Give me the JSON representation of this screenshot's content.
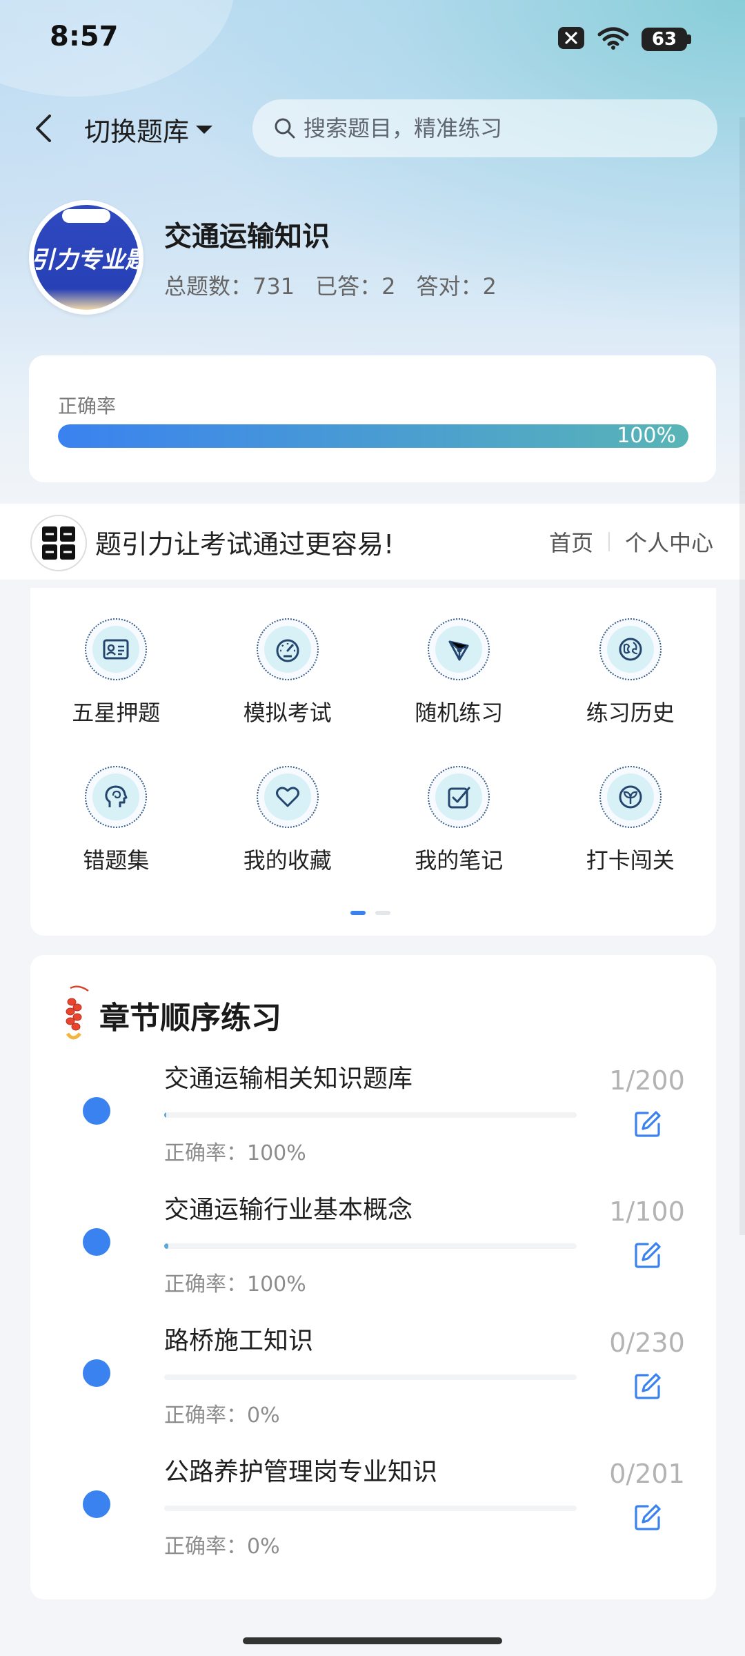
{
  "status": {
    "time": "8:57",
    "battery": "63"
  },
  "top": {
    "switch_label": "切换题库",
    "search_placeholder": "搜索题目，精准练习"
  },
  "bank": {
    "logo_text": "引力专业题",
    "title": "交通运输知识",
    "stats": {
      "total": "总题数：731",
      "answered": "已答：2",
      "correct": "答对：2"
    }
  },
  "accuracy": {
    "label": "正确率",
    "value_text": "100%",
    "value": 100
  },
  "banner": {
    "text": "题引力让考试通过更容易!",
    "links": [
      "首页",
      "个人中心"
    ]
  },
  "features": [
    {
      "label": "五星押题",
      "icon": "id-card-icon"
    },
    {
      "label": "模拟考试",
      "icon": "speedometer-icon"
    },
    {
      "label": "随机练习",
      "icon": "network-icon"
    },
    {
      "label": "练习历史",
      "icon": "globe-icon"
    },
    {
      "label": "错题集",
      "icon": "brain-head-icon"
    },
    {
      "label": "我的收藏",
      "icon": "heart-icon"
    },
    {
      "label": "我的笔记",
      "icon": "checklist-icon"
    },
    {
      "label": "打卡闯关",
      "icon": "sprout-icon"
    }
  ],
  "chapters": {
    "title": "章节顺序练习",
    "items": [
      {
        "name": "交通运输相关知识题库",
        "accuracy": "正确率：100%",
        "count": "1/200",
        "progress": 0.005
      },
      {
        "name": "交通运输行业基本概念",
        "accuracy": "正确率：100%",
        "count": "1/100",
        "progress": 0.01
      },
      {
        "name": "路桥施工知识",
        "accuracy": "正确率：0%",
        "count": "0/230",
        "progress": 0
      },
      {
        "name": "公路养护管理岗专业知识",
        "accuracy": "正确率：0%",
        "count": "0/201",
        "progress": 0
      }
    ]
  },
  "colors": {
    "accent": "#3a82f0",
    "teal": "#58b5b6"
  }
}
